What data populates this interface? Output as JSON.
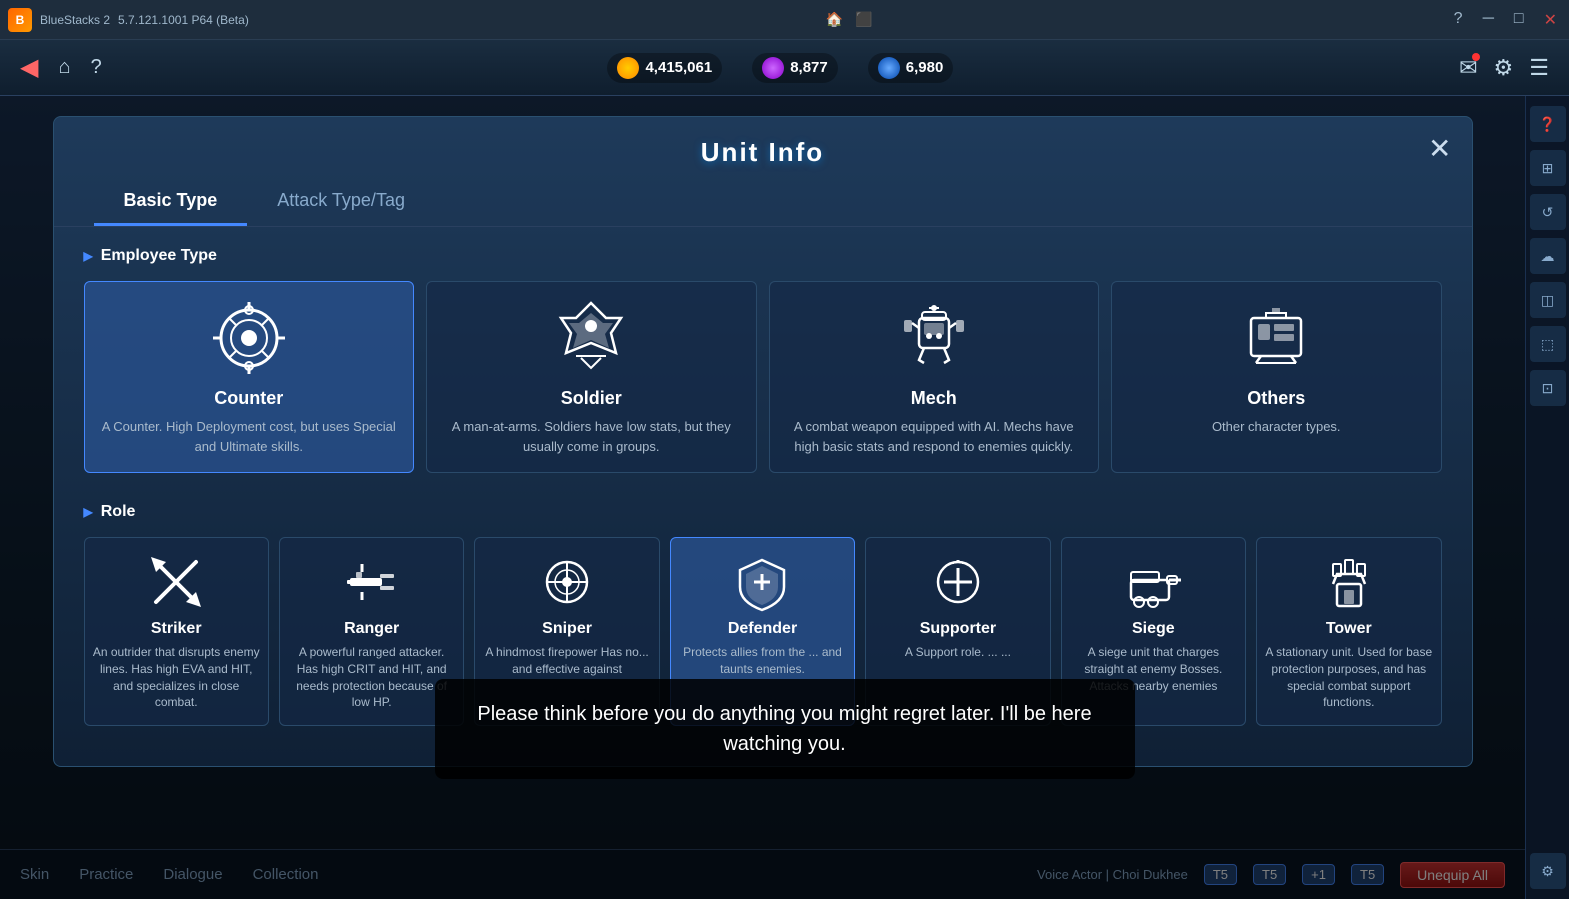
{
  "titleBar": {
    "appName": "BlueStacks 2",
    "version": "5.7.121.1001 P64 (Beta)"
  },
  "topNav": {
    "currency": {
      "gold": "4,415,061",
      "gem": "8,877",
      "crystal": "6,980"
    }
  },
  "modal": {
    "title": "Unit Info",
    "closeLabel": "✕",
    "tabs": [
      {
        "id": "basic",
        "label": "Basic Type",
        "active": true
      },
      {
        "id": "attack",
        "label": "Attack Type/Tag",
        "active": false
      }
    ],
    "sections": {
      "employeeType": {
        "header": "Employee Type",
        "cards": [
          {
            "id": "counter",
            "name": "Counter",
            "desc": "A Counter.\nHigh Deployment cost,\nbut uses Special and Ultimate skills.",
            "selected": true
          },
          {
            "id": "soldier",
            "name": "Soldier",
            "desc": "A man-at-arms.\nSoldiers have low stats,\nbut they usually come in groups."
          },
          {
            "id": "mech",
            "name": "Mech",
            "desc": "A combat weapon equipped with AI.\nMechs have high basic stats\nand respond to enemies quickly."
          },
          {
            "id": "others",
            "name": "Others",
            "desc": "Other character types."
          }
        ]
      },
      "role": {
        "header": "Role",
        "cards": [
          {
            "id": "striker",
            "name": "Striker",
            "desc": "An outrider that\ndisrupts enemy lines.\nHas high EVA and HIT,\nand specializes in close\ncombat."
          },
          {
            "id": "ranger",
            "name": "Ranger",
            "desc": "A powerful ranged\nattacker.\nHas high CRIT and HIT,\nand needs protection\nbecause of low HP."
          },
          {
            "id": "sniper",
            "name": "Sniper",
            "desc": "A hindmost firepower\nHas no...\nand effective against"
          },
          {
            "id": "defender",
            "name": "Defender",
            "desc": "Protects allies from the\n...\nand taunts enemies.",
            "selected": true
          },
          {
            "id": "supporter",
            "name": "Supporter",
            "desc": "A Support role.\n...\n..."
          },
          {
            "id": "siege",
            "name": "Siege",
            "desc": "A siege unit that\ncharges\nstraight at enemy\nBosses.\nAttacks nearby enemies"
          },
          {
            "id": "tower",
            "name": "Tower",
            "desc": "A stationary unit.\nUsed for base\nprotection purposes,\nand has special combat\nsupport functions."
          }
        ]
      }
    }
  },
  "notification": {
    "text": "Please think before you do anything you might\nregret later. I'll be here watching you."
  },
  "bottomNav": {
    "items": [
      "Skin",
      "Practice",
      "Dialogue",
      "Collection"
    ],
    "actor": "Voice Actor | Choi Dukhee",
    "badges": [
      "T5",
      "T5",
      "+1",
      "T5"
    ],
    "unequipBtn": "Unequip All"
  },
  "sidebar": {
    "icons": [
      "❓",
      "⊞",
      "↻",
      "☁",
      "◫",
      "⬚",
      "⊡"
    ]
  }
}
